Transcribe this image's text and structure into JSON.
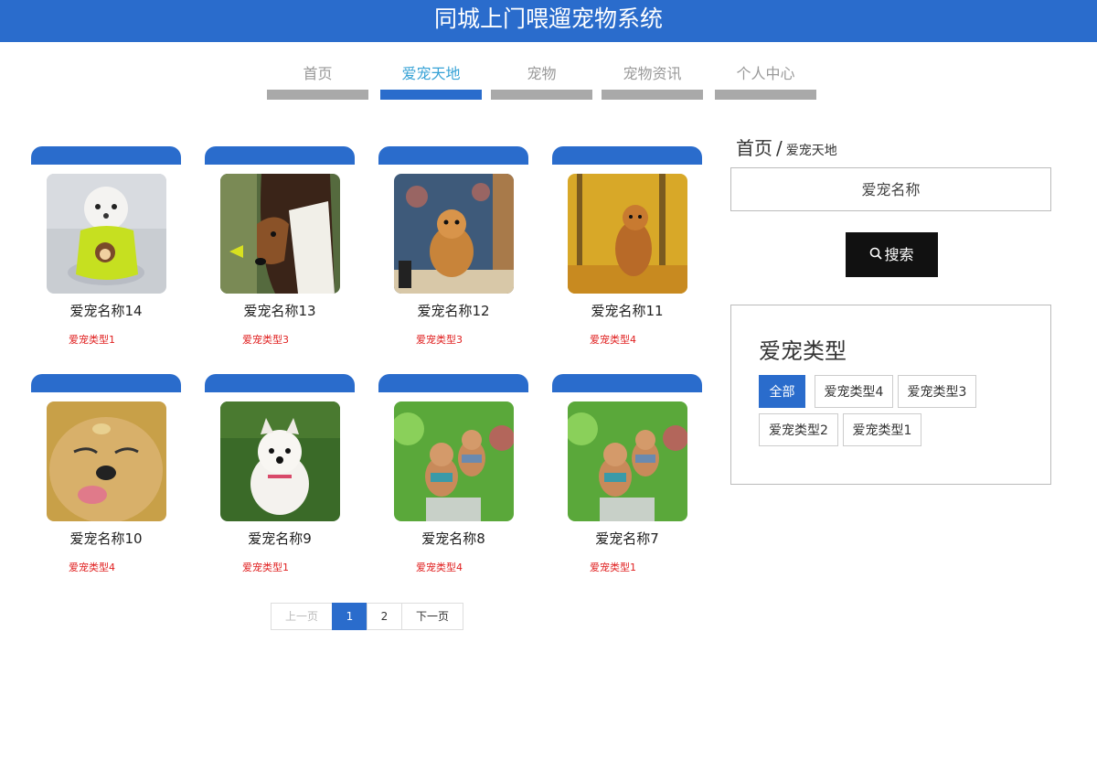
{
  "header": {
    "title": "同城上门喂遛宠物系统"
  },
  "nav": [
    {
      "label": "首页"
    },
    {
      "label": "爱宠天地",
      "active": true
    },
    {
      "label": "宠物"
    },
    {
      "label": "宠物资讯"
    },
    {
      "label": "个人中心"
    }
  ],
  "pets": [
    {
      "name": "爱宠名称14",
      "type": "爱宠类型1",
      "image": "white-puppy-yellow-shirt"
    },
    {
      "name": "爱宠名称13",
      "type": "爱宠类型3",
      "image": "collie"
    },
    {
      "name": "爱宠名称12",
      "type": "爱宠类型3",
      "image": "puppy-vintage-room"
    },
    {
      "name": "爱宠名称11",
      "type": "爱宠类型4",
      "image": "golden-dog-autumn"
    },
    {
      "name": "爱宠名称10",
      "type": "爱宠类型4",
      "image": "golden-retriever-closeup"
    },
    {
      "name": "爱宠名称9",
      "type": "爱宠类型1",
      "image": "westie-on-grass"
    },
    {
      "name": "爱宠名称8",
      "type": "爱宠类型4",
      "image": "poodles-in-garden"
    },
    {
      "name": "爱宠名称7",
      "type": "爱宠类型1",
      "image": "poodles-in-garden"
    }
  ],
  "pagination": {
    "prev": "上一页",
    "pages": [
      "1",
      "2"
    ],
    "current": "1",
    "next": "下一页"
  },
  "breadcrumb": {
    "home": "首页",
    "separator": "/",
    "current": "爱宠天地"
  },
  "search": {
    "placeholder": "爱宠名称",
    "button": "搜索",
    "icon": "search-icon"
  },
  "types": {
    "title": "爱宠类型",
    "tags": [
      {
        "label": "全部",
        "selected": true
      },
      {
        "label": "爱宠类型4"
      },
      {
        "label": "爱宠类型3"
      },
      {
        "label": "爱宠类型2"
      },
      {
        "label": "爱宠类型1"
      }
    ]
  },
  "colors": {
    "primary": "#2a6ccc",
    "nav_active": "#36a2d6",
    "type_text": "#e02020"
  }
}
